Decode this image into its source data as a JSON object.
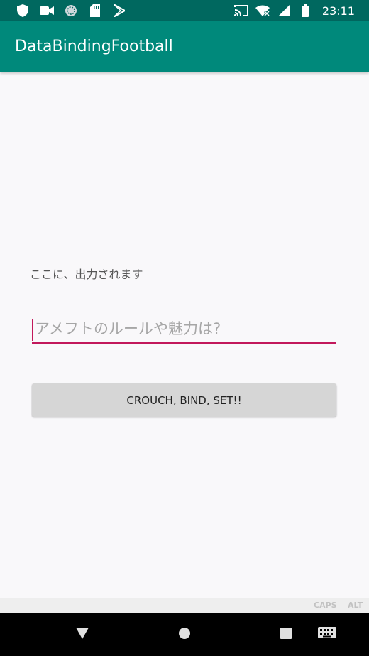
{
  "status_bar": {
    "time": "23:11",
    "left_icons": [
      "shield-icon",
      "video-camera-icon",
      "sync-circle-icon",
      "sd-card-icon",
      "play-store-icon"
    ],
    "right_icons": [
      "cast-icon",
      "wifi-off-icon",
      "cell-signal-icon",
      "battery-icon"
    ],
    "background_color": "#00685f"
  },
  "app_bar": {
    "title": "DataBindingFootball",
    "background_color": "#00897b"
  },
  "main": {
    "output_text": "ここに、出力されます",
    "input": {
      "value": "",
      "placeholder": "アメフトのルールや魅力は?"
    },
    "button_label": "CROUCH, BIND, SET!!",
    "accent_color": "#c2185b"
  },
  "keyboard_hints": {
    "caps": "CAPS",
    "alt": "ALT"
  },
  "nav_bar": {
    "buttons": [
      "back-icon",
      "home-icon",
      "recents-icon",
      "keyboard-icon"
    ]
  }
}
